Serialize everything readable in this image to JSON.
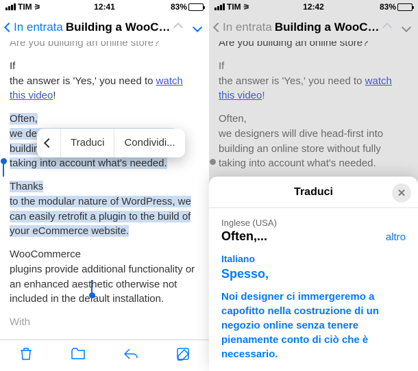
{
  "left": {
    "status": {
      "carrier": "TIM",
      "time": "12:41",
      "battery": "83%"
    },
    "nav": {
      "back": "In entrata",
      "title": "Building a WooCo..."
    },
    "body": {
      "line0": "Are you building an online store?",
      "if": "If",
      "answer": " the answer is 'Yes,' you need to ",
      "watch": "watch",
      "video": " this video",
      "bang": "!",
      "often": "Often,",
      "designers": " we designers will dive head-first into building an online store without fully taking into account what's needed.",
      "thanks": "Thanks",
      "modular": " to the modular nature of WordPress, we can easily retrofit a plugin to the build of your eCommerce website.",
      "woo": "WooCommerce",
      "plugins": " plugins provide additional functionality or an enhanced aesthetic otherwise not included in the default installation.",
      "with": "With"
    },
    "popover": {
      "translate": "Traduci",
      "share": "Condividi..."
    }
  },
  "right": {
    "status": {
      "carrier": "TIM",
      "time": "12:42",
      "battery": "83%"
    },
    "nav": {
      "back": "In entrata",
      "title": "Building a WooCo..."
    },
    "sheet": {
      "title": "Traduci",
      "src_lang": "Inglese (USA)",
      "src_text": "Often,...",
      "more": "altro",
      "tgt_lang": "Italiano",
      "tgt_word": "Spesso,",
      "translation": "Noi designer ci immergeremo a capofitto nella costruzione di un negozio online senza tenere pienamente conto di ciò che è necessario."
    }
  }
}
